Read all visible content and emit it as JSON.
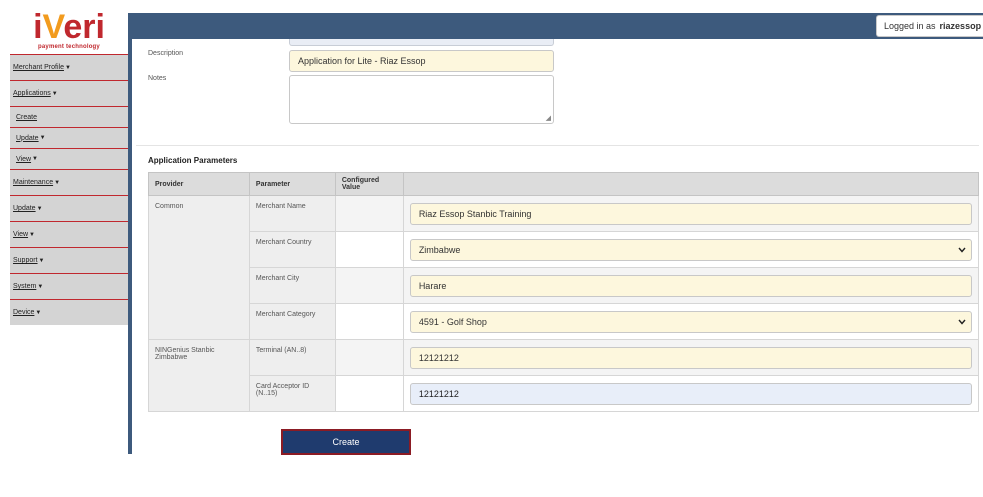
{
  "logo": {
    "text_a": "i",
    "text_v": "V",
    "text_b": "eri",
    "tagline": "payment technology"
  },
  "header": {
    "logged_prefix": "Logged in as",
    "username": "riazessop"
  },
  "sidebar": {
    "items": [
      {
        "label": "Merchant Profile",
        "sub": false,
        "caret": true
      },
      {
        "label": "Applications",
        "sub": false,
        "caret": true
      },
      {
        "label": "Create",
        "sub": true,
        "caret": false
      },
      {
        "label": "Update",
        "sub": true,
        "caret": true
      },
      {
        "label": "View",
        "sub": true,
        "caret": true
      },
      {
        "label": "Maintenance",
        "sub": false,
        "caret": true
      },
      {
        "label": "Update",
        "sub": false,
        "caret": true
      },
      {
        "label": "View",
        "sub": false,
        "caret": true
      },
      {
        "label": "Support",
        "sub": false,
        "caret": true
      },
      {
        "label": "System",
        "sub": false,
        "caret": true
      },
      {
        "label": "Device",
        "sub": false,
        "caret": true
      }
    ]
  },
  "form": {
    "description_label": "Description",
    "description_value": "Application for Lite - Riaz Essop",
    "notes_label": "Notes",
    "notes_value": ""
  },
  "params": {
    "title": "Application Parameters",
    "headers": [
      "Provider",
      "Parameter",
      "Configured Value",
      ""
    ],
    "groups": [
      {
        "provider": "Common",
        "rows": [
          {
            "param": "Merchant Name",
            "configured": "",
            "value": "Riaz Essop Stanbic Training",
            "type": "text"
          },
          {
            "param": "Merchant Country",
            "configured": "",
            "value": "Zimbabwe",
            "type": "select"
          },
          {
            "param": "Merchant City",
            "configured": "",
            "value": "Harare",
            "type": "text"
          },
          {
            "param": "Merchant Category",
            "configured": "",
            "value": "4591 - Golf Shop",
            "type": "select"
          }
        ]
      },
      {
        "provider": "NINGenius Stanbic Zimbabwe",
        "rows": [
          {
            "param": "Terminal (AN..8)",
            "configured": "",
            "value": "12121212",
            "type": "text"
          },
          {
            "param": "Card Acceptor ID (N..15)",
            "configured": "",
            "value": "12121212",
            "type": "text-active"
          }
        ]
      }
    ]
  },
  "actions": {
    "create_label": "Create"
  },
  "icons": {
    "caret": "caret-down-icon",
    "chevron": "chevron-down-icon",
    "resize": "resize-handle-icon"
  },
  "colors": {
    "brand_red": "#c0282e",
    "brand_orange": "#f29b1e",
    "header_blue": "#3d5a7d",
    "button_blue": "#1f3b6e"
  }
}
